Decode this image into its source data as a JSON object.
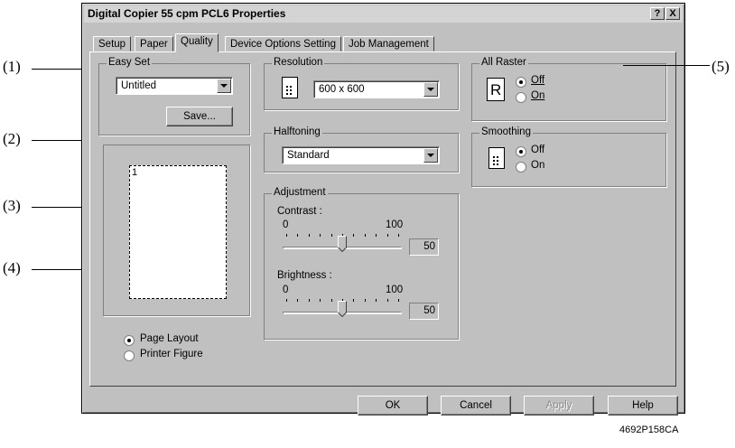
{
  "callouts": [
    "(1)",
    "(2)",
    "(3)",
    "(4)",
    "(5)"
  ],
  "dialog": {
    "title": "Digital Copier 55 cpm PCL6 Properties",
    "help_btn": "?",
    "close_btn": "X"
  },
  "tabs": [
    "Setup",
    "Paper",
    "Quality",
    "Device Options Setting",
    "Job Management"
  ],
  "active_tab": "Quality",
  "easy_set": {
    "label": "Easy Set",
    "value": "Untitled",
    "save_label": "Save..."
  },
  "preview": {
    "page_number": "1",
    "options": [
      "Page Layout",
      "Printer Figure"
    ],
    "selected": "Page Layout"
  },
  "resolution": {
    "label": "Resolution",
    "value": "600 x 600"
  },
  "halftoning": {
    "label": "Halftoning",
    "value": "Standard"
  },
  "adjustment": {
    "label": "Adjustment",
    "contrast": {
      "label": "Contrast :",
      "min": "0",
      "max": "100",
      "value": "50",
      "level": 50
    },
    "brightness": {
      "label": "Brightness :",
      "min": "0",
      "max": "100",
      "value": "50",
      "level": 50
    }
  },
  "all_raster": {
    "label": "All Raster",
    "icon_letter": "R",
    "options": [
      "Off",
      "On"
    ],
    "selected": "Off"
  },
  "smoothing": {
    "label": "Smoothing",
    "options": [
      "Off",
      "On"
    ],
    "selected": "Off"
  },
  "buttons": {
    "ok": "OK",
    "cancel": "Cancel",
    "apply": "Apply",
    "help": "Help"
  },
  "figure_code": "4692P158CA"
}
